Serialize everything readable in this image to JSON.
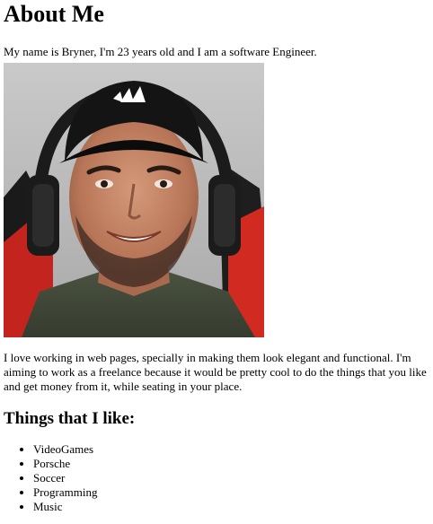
{
  "page": {
    "heading": "About Me",
    "intro": "My name is Bryner, I'm 23 years old and I am a software Engineer.",
    "photo": {
      "cap_logo_text": "adidas"
    },
    "bio": "I love working in web pages, specially in making them look elegant and functional. I'm aiming to work as a freelance because it would be pretty cool to do the things that you like and get money from it, while seating in your place.",
    "likes_heading": "Things that I like:",
    "likes": [
      "VideoGames",
      "Porsche",
      "Soccer",
      "Programming",
      "Music"
    ]
  }
}
